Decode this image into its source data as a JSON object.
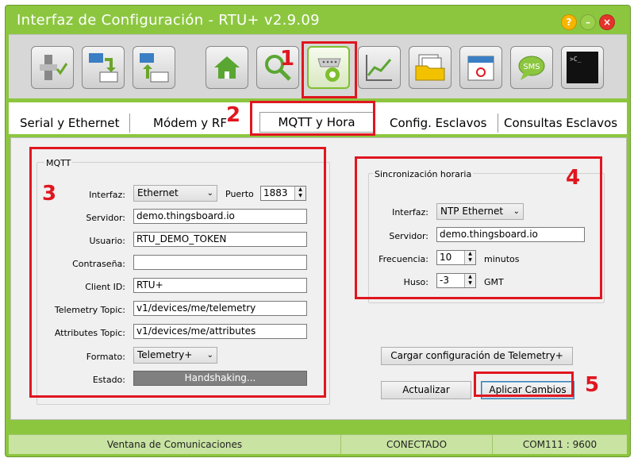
{
  "window": {
    "title": "Interfaz de Configuración - RTU+ v2.9.09",
    "help_label": "?",
    "min_label": "–",
    "close_label": "×"
  },
  "toolbar": {
    "icons": [
      "device-check-icon",
      "download-rtu-icon",
      "upload-rtu-icon",
      "home-icon",
      "search-icon",
      "serial-config-icon",
      "chart-icon",
      "folders-icon",
      "calendar-icon",
      "sms-icon",
      "terminal-icon"
    ],
    "sms_text": "SMS",
    "terminal_text": ">C_"
  },
  "annotations": {
    "n1": "1",
    "n2": "2",
    "n3": "3",
    "n4": "4",
    "n5": "5"
  },
  "tabs": {
    "serial": "Serial y Ethernet",
    "modem": "Módem y RF",
    "mqtt": "MQTT y Hora",
    "slaves": "Config. Esclavos",
    "queries": "Consultas Esclavos"
  },
  "mqtt": {
    "group_label": "MQTT",
    "interface_label": "Interfaz:",
    "interface_value": "Ethernet",
    "port_label": "Puerto",
    "port_value": "1883",
    "server_label": "Servidor:",
    "server_value": "demo.thingsboard.io",
    "user_label": "Usuario:",
    "user_value": "RTU_DEMO_TOKEN",
    "password_label": "Contraseña:",
    "password_value": "",
    "client_label": "Client ID:",
    "client_value": "RTU+",
    "telemetry_label": "Telemetry Topic:",
    "telemetry_value": "v1/devices/me/telemetry",
    "attributes_label": "Attributes Topic:",
    "attributes_value": "v1/devices/me/attributes",
    "format_label": "Formato:",
    "format_value": "Telemetry+",
    "state_label": "Estado:",
    "state_value": "Handshaking..."
  },
  "sync": {
    "group_label": "Sincronización horaria",
    "interface_label": "Interfaz:",
    "interface_value": "NTP Ethernet",
    "server_label": "Servidor:",
    "server_value": "demo.thingsboard.io",
    "freq_label": "Frecuencia:",
    "freq_value": "10",
    "freq_unit": "minutos",
    "tz_label": "Huso:",
    "tz_value": "-3",
    "tz_unit": "GMT"
  },
  "actions": {
    "load_telemetry": "Cargar configuración de Telemetry+",
    "refresh": "Actualizar",
    "apply": "Aplicar Cambios"
  },
  "status": {
    "comm_window": "Ventana de Comunicaciones",
    "connection": "CONECTADO",
    "port": "COM111 : 9600"
  },
  "colors": {
    "accent_green": "#8cc63f",
    "annotation_red": "#e0161f"
  }
}
